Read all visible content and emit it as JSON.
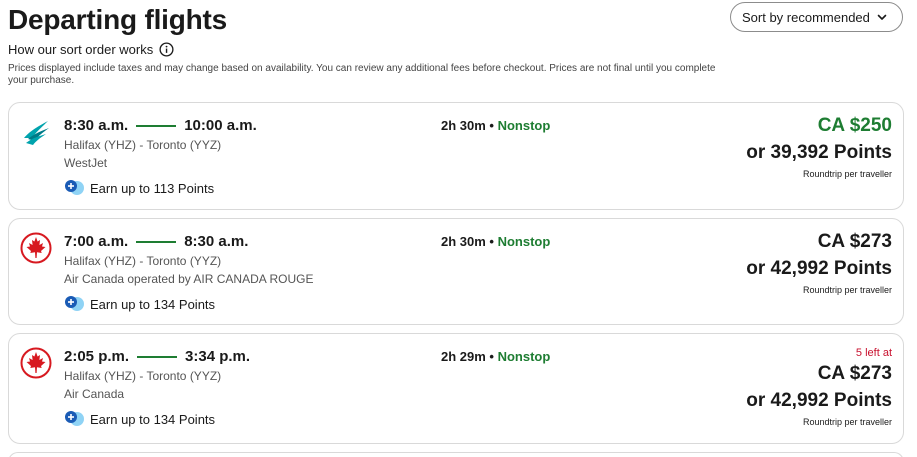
{
  "header": {
    "title": "Departing flights",
    "sort_label": "Sort by recommended",
    "sort_info": "How our sort order works",
    "disclaimer": "Prices displayed include taxes and may change based on availability. You can review any additional fees before checkout. Prices are not final until you complete your purchase."
  },
  "colors": {
    "green": "#1e7d32",
    "red": "#c8102e",
    "westjet_teal": "#00a3ad"
  },
  "flights": [
    {
      "logo": "westjet-logo",
      "depart": "8:30 a.m.",
      "arrive": "10:00 a.m.",
      "route": "Halifax (YHZ) - Toronto (YYZ)",
      "airline": "WestJet",
      "points_earn": "Earn up to 113 Points",
      "duration": "2h 30m",
      "stops": "Nonstop",
      "seats_left": "",
      "price": "CA $250",
      "price_points": "or 39,392 Points",
      "price_note": "Roundtrip per traveller"
    },
    {
      "logo": "air-canada-logo",
      "depart": "7:00 a.m.",
      "arrive": "8:30 a.m.",
      "route": "Halifax (YHZ) - Toronto (YYZ)",
      "airline": "Air Canada operated by AIR CANADA ROUGE",
      "points_earn": "Earn up to 134 Points",
      "duration": "2h 30m",
      "stops": "Nonstop",
      "seats_left": "",
      "price": "CA $273",
      "price_points": "or 42,992 Points",
      "price_note": "Roundtrip per traveller"
    },
    {
      "logo": "air-canada-logo",
      "depart": "2:05 p.m.",
      "arrive": "3:34 p.m.",
      "route": "Halifax (YHZ) - Toronto (YYZ)",
      "airline": "Air Canada",
      "points_earn": "Earn up to 134 Points",
      "duration": "2h 29m",
      "stops": "Nonstop",
      "seats_left": "5 left at",
      "price": "CA $273",
      "price_points": "or 42,992 Points",
      "price_note": "Roundtrip per traveller"
    }
  ]
}
